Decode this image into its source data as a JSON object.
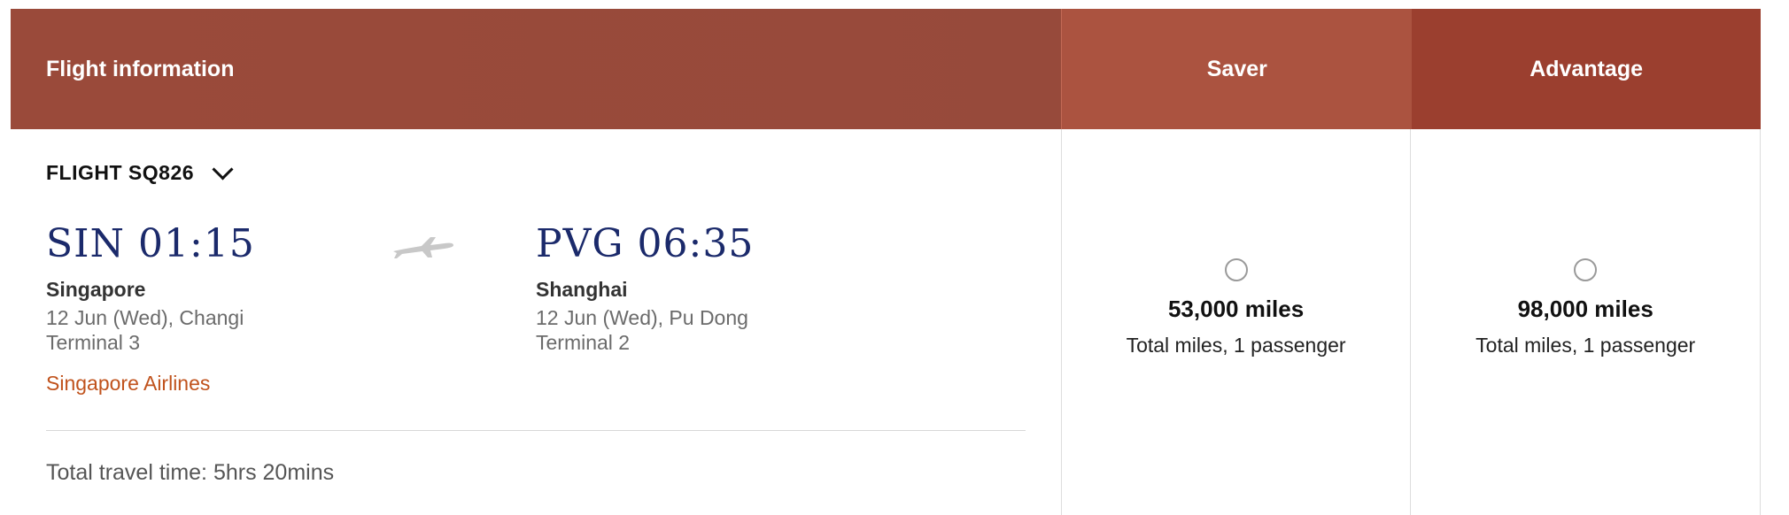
{
  "header": {
    "flight_info_label": "Flight information",
    "saver_label": "Saver",
    "advantage_label": "Advantage"
  },
  "flight": {
    "label": "FLIGHT SQ826",
    "departure": {
      "time": "SIN 01:15",
      "city": "Singapore",
      "date_airport": "12 Jun (Wed), Changi",
      "terminal": "Terminal 3"
    },
    "arrival": {
      "time": "PVG 06:35",
      "city": "Shanghai",
      "date_airport": "12 Jun (Wed), Pu Dong",
      "terminal": "Terminal 2"
    },
    "airline": "Singapore Airlines",
    "total_travel_time": "Total travel time: 5hrs 20mins"
  },
  "fares": {
    "saver": {
      "miles": "53,000 miles",
      "note": "Total miles, 1 passenger"
    },
    "advantage": {
      "miles": "98,000 miles",
      "note": "Total miles, 1 passenger"
    }
  },
  "icons": {
    "expand": "chevron-down-icon",
    "plane": "airplane-icon",
    "radio": "radio-button-icon"
  },
  "colors": {
    "header_info": "#9a4a3a",
    "header_saver": "#ab5340",
    "header_advantage": "#9b3f2f",
    "time_text": "#1b2a6b",
    "airline_text": "#c0521c"
  }
}
